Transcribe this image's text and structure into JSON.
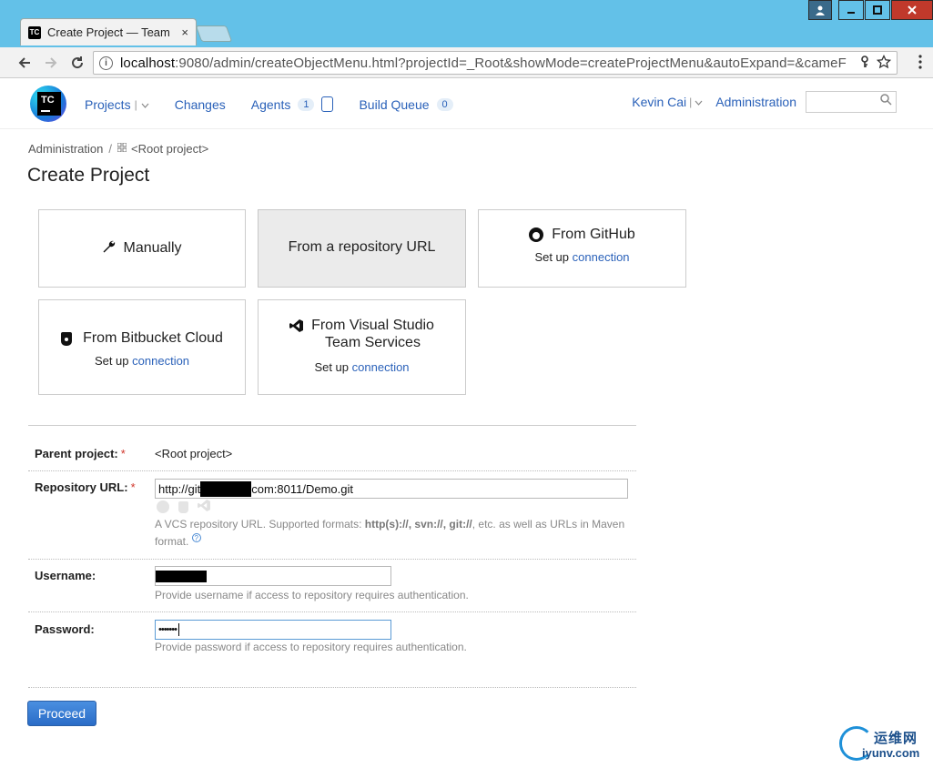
{
  "browser": {
    "tab_title": "Create Project — Team",
    "tab_favicon_text": "TC",
    "tab_close": "×",
    "url_host": "localhost",
    "url_path": ":9080/admin/createObjectMenu.html?projectId=_Root&showMode=createProjectMenu&autoExpand=&cameF",
    "info_icon_char": "i",
    "back_icon": "arrow-left-icon",
    "forward_icon": "arrow-right-icon",
    "reload_icon": "reload-icon",
    "window_controls": {
      "user_icon": "user-icon",
      "minimize": "minimize-icon",
      "maximize": "maximize-icon",
      "close": "close-icon"
    }
  },
  "header": {
    "logo_text": "TC",
    "nav": {
      "projects": "Projects",
      "changes": "Changes",
      "agents": "Agents",
      "agents_count": "1",
      "build_queue": "Build Queue",
      "build_queue_count": "0"
    },
    "user": "Kevin Cai",
    "administration": "Administration",
    "search_placeholder": ""
  },
  "breadcrumb": {
    "admin": "Administration",
    "separator": "/",
    "root": "<Root project>"
  },
  "page_title": "Create Project",
  "cards": {
    "manually": "Manually",
    "from_repo_url": "From a repository URL",
    "github": {
      "title": "From GitHub",
      "setup": "Set up",
      "link": "connection"
    },
    "bitbucket": {
      "title": "From Bitbucket Cloud",
      "setup": "Set up",
      "link": "connection"
    },
    "vsts": {
      "title_line1": "From Visual Studio",
      "title_line2": "Team Services",
      "setup": "Set up",
      "link": "connection"
    }
  },
  "form": {
    "parent_label": "Parent project:",
    "parent_value": "<Root project>",
    "required_mark": "*",
    "repo_label": "Repository URL:",
    "repo_value_prefix": "http://git",
    "repo_value_suffix": "com:8011/Demo.git",
    "repo_hint_1": "A VCS repository URL. Supported formats: ",
    "repo_hint_formats": "http(s)://, svn://, git://",
    "repo_hint_2": ", etc. as well as URLs in Maven",
    "repo_hint_3": "format.",
    "help_icon_char": "?",
    "username_label": "Username:",
    "username_hint": "Provide username if access to repository requires authentication.",
    "password_label": "Password:",
    "password_value": "•••••••",
    "password_hint": "Provide password if access to repository requires authentication.",
    "proceed": "Proceed"
  },
  "watermark": {
    "cn": "运维网",
    "en": "iyunv.com"
  },
  "colors": {
    "link": "#2a61b9",
    "chrome": "#63c1e8",
    "primary_button": "#2a6cc7",
    "required": "#d0352a"
  }
}
